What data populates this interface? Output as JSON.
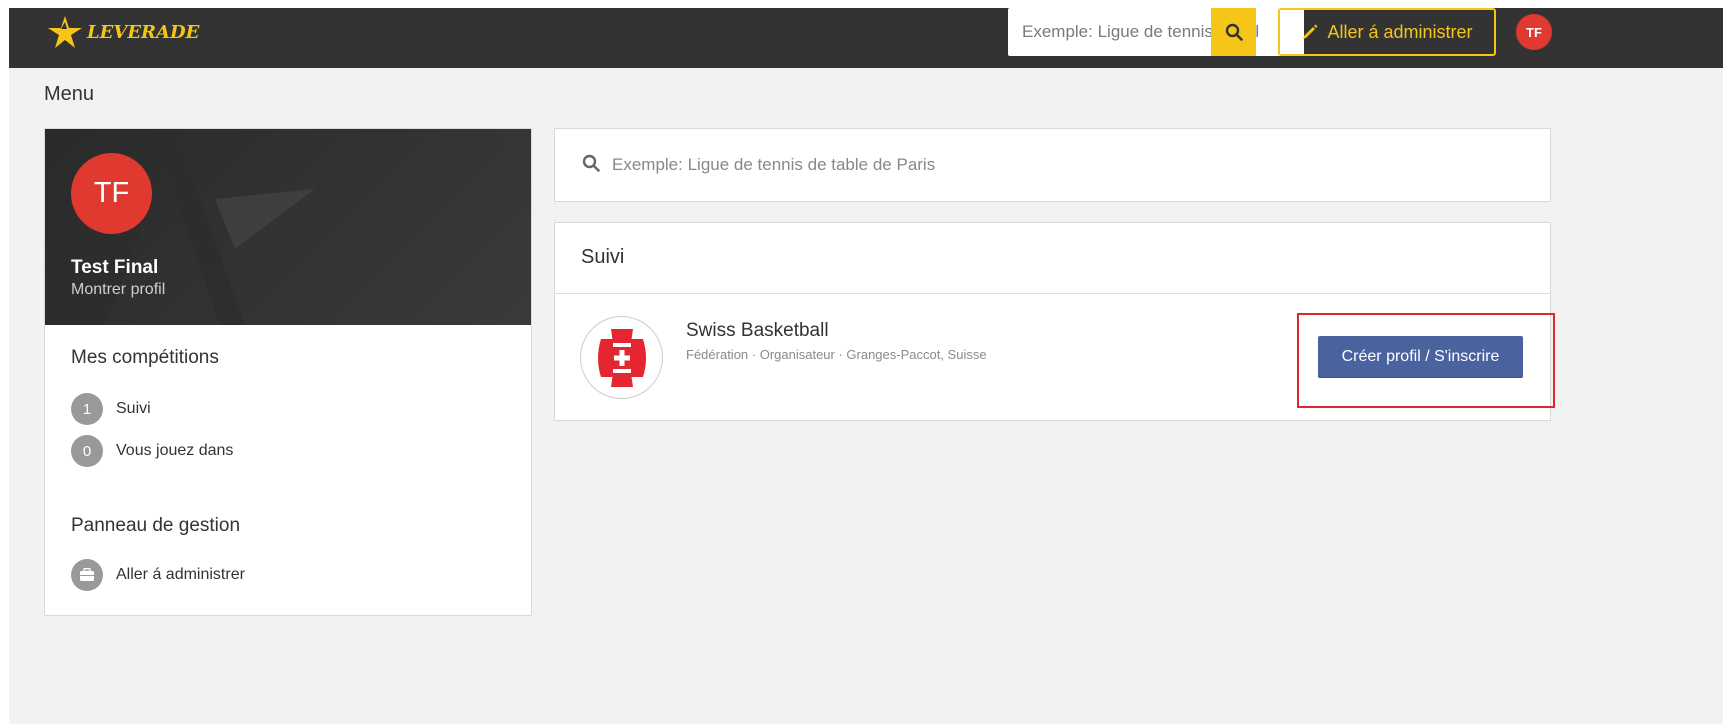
{
  "header": {
    "logo_text": "LEVERADE",
    "search_placeholder": "Exemple: Ligue de tennis de table de Paris",
    "admin_button_label": "Aller á administrer",
    "user_initials": "TF",
    "colors": {
      "bar": "#333333",
      "accent": "#f5c518",
      "avatar": "#e03a30"
    }
  },
  "page": {
    "menu_label": "Menu"
  },
  "sidebar": {
    "profile": {
      "initials": "TF",
      "name": "Test Final",
      "link": "Montrer profil"
    },
    "competitions": {
      "title": "Mes compétitions",
      "items": [
        {
          "count": "1",
          "label": "Suivi"
        },
        {
          "count": "0",
          "label": "Vous jouez dans"
        }
      ]
    },
    "management": {
      "title": "Panneau de gestion",
      "item_label": "Aller á administrer",
      "item_icon": "briefcase-icon"
    }
  },
  "main": {
    "search_placeholder": "Exemple: Ligue de tennis de table de Paris",
    "followed": {
      "title": "Suivi",
      "items": [
        {
          "name": "Swiss Basketball",
          "meta": "Fédération · Organisateur · Granges-Paccot, Suisse",
          "cta_label": "Créer profil / S'inscrire",
          "cta_color": "#4a639f"
        }
      ]
    }
  }
}
